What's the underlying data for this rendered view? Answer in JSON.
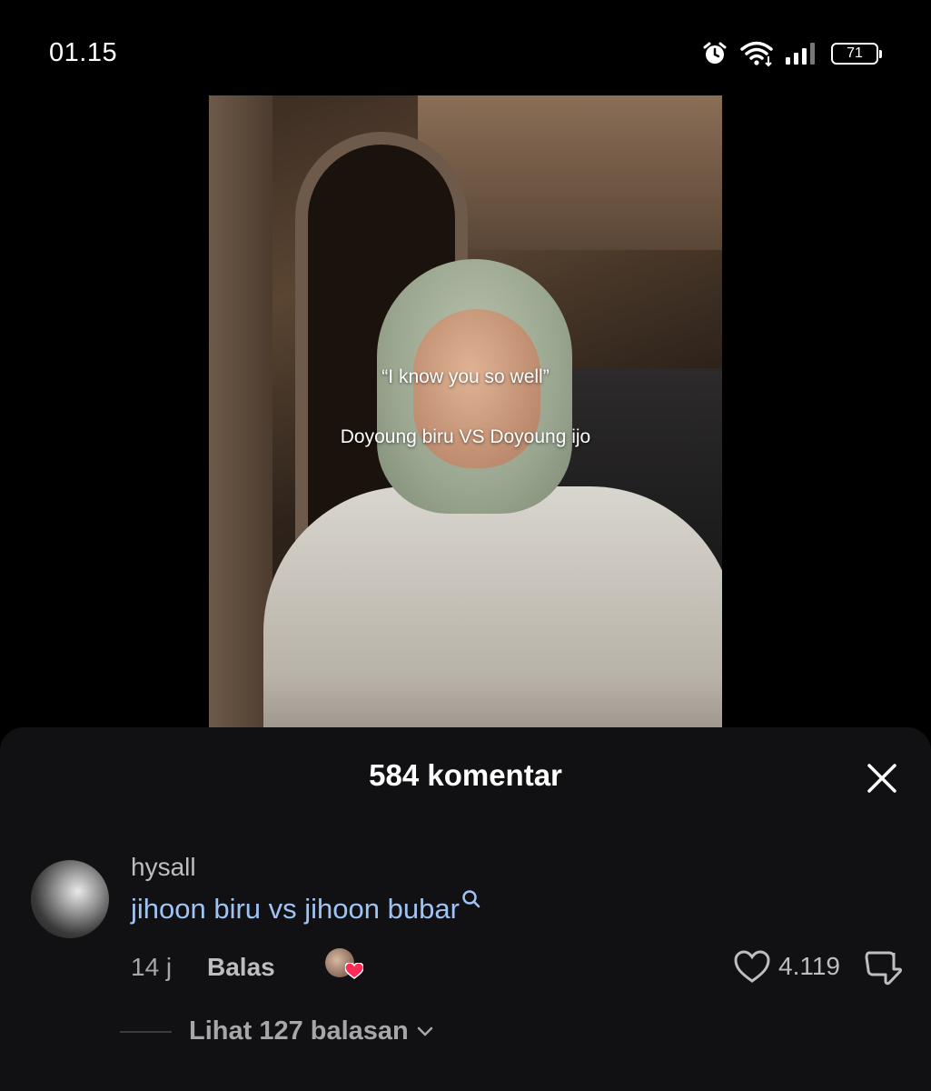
{
  "status_bar": {
    "time": "01.15",
    "battery": "71",
    "icons": [
      "alarm-icon",
      "wifi-icon",
      "signal-icon",
      "battery-icon"
    ]
  },
  "video": {
    "caption_line1": "“I know you so well”",
    "caption_line2": "Doyoung biru VS Doyoung ijo"
  },
  "comments_sheet": {
    "title": "584 komentar",
    "comment": {
      "username": "hysall",
      "text": "jihoon biru vs jihoon bubar",
      "time": "14 j",
      "reply_label": "Balas",
      "like_count": "4.119",
      "view_replies_label": "Lihat 127 balasan"
    }
  },
  "colors": {
    "sheet_background": "#111113",
    "comment_link_color": "#9fc3f4",
    "creator_heart": "#fe2c55"
  }
}
